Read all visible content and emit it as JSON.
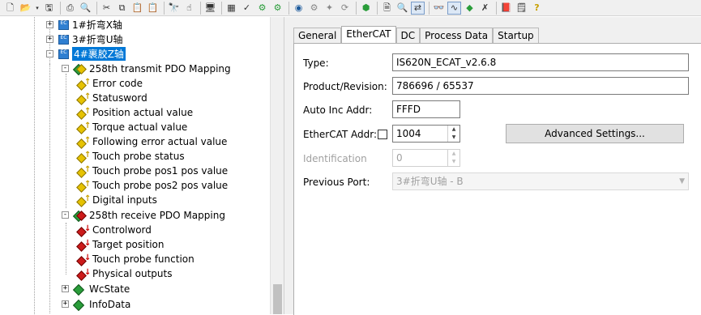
{
  "toolbar": {
    "icons": [
      "new-file-icon",
      "open-folder-icon",
      "dropdown-icon",
      "save-icon",
      "print-icon",
      "print-preview-icon",
      "cut-icon",
      "copy-icon",
      "paste-icon",
      "paste-special-icon",
      "find-icon",
      "cursor-icon",
      "target-icon",
      "config-icon",
      "check-icon",
      "build-icon",
      "activate-icon",
      "run-mode-icon",
      "restart-icon",
      "wand-icon",
      "cycle-icon",
      "link-icon",
      "document-icon",
      "zoom-icon",
      "scan-icon",
      "glasses-icon",
      "scope-icon",
      "scope-alt-icon",
      "book-icon",
      "help-document-icon",
      "help-icon"
    ]
  },
  "tree": {
    "devices": [
      {
        "label": "1#折弯X轴",
        "expander": "+"
      },
      {
        "label": "3#折弯U轴",
        "expander": "+"
      },
      {
        "label": "4#裹胶Z轴",
        "expander": "-",
        "selected": true
      }
    ],
    "tx_mapping": {
      "label": "258th transmit PDO Mapping",
      "expander": "-"
    },
    "tx_vars": [
      "Error code",
      "Statusword",
      "Position actual value",
      "Torque actual value",
      "Following error actual value",
      "Touch probe status",
      "Touch probe pos1 pos value",
      "Touch probe pos2 pos value",
      "Digital inputs"
    ],
    "rx_mapping": {
      "label": "258th receive PDO Mapping",
      "expander": "-"
    },
    "rx_vars": [
      "Controlword",
      "Target position",
      "Touch probe function",
      "Physical outputs"
    ],
    "extra": [
      {
        "label": "WcState",
        "expander": "+"
      },
      {
        "label": "InfoData",
        "expander": "+"
      }
    ],
    "device_icon_text": "EC\nDRV"
  },
  "tabs": [
    "General",
    "EtherCAT",
    "DC",
    "Process Data",
    "Startup"
  ],
  "active_tab": "EtherCAT",
  "form": {
    "type_label": "Type:",
    "type_value": "IS620N_ECAT_v2.6.8",
    "product_label": "Product/Revision:",
    "product_value": "786696 / 65537",
    "autoinc_label": "Auto Inc Addr:",
    "autoinc_value": "FFFD",
    "ecat_addr_label": "EtherCAT Addr:",
    "ecat_addr_value": "1004",
    "ecat_addr_checked": false,
    "advanced_button": "Advanced Settings...",
    "identification_label": "Identification",
    "identification_value": "0",
    "prev_port_label": "Previous Port:",
    "prev_port_value": "3#折弯U轴 - B"
  }
}
